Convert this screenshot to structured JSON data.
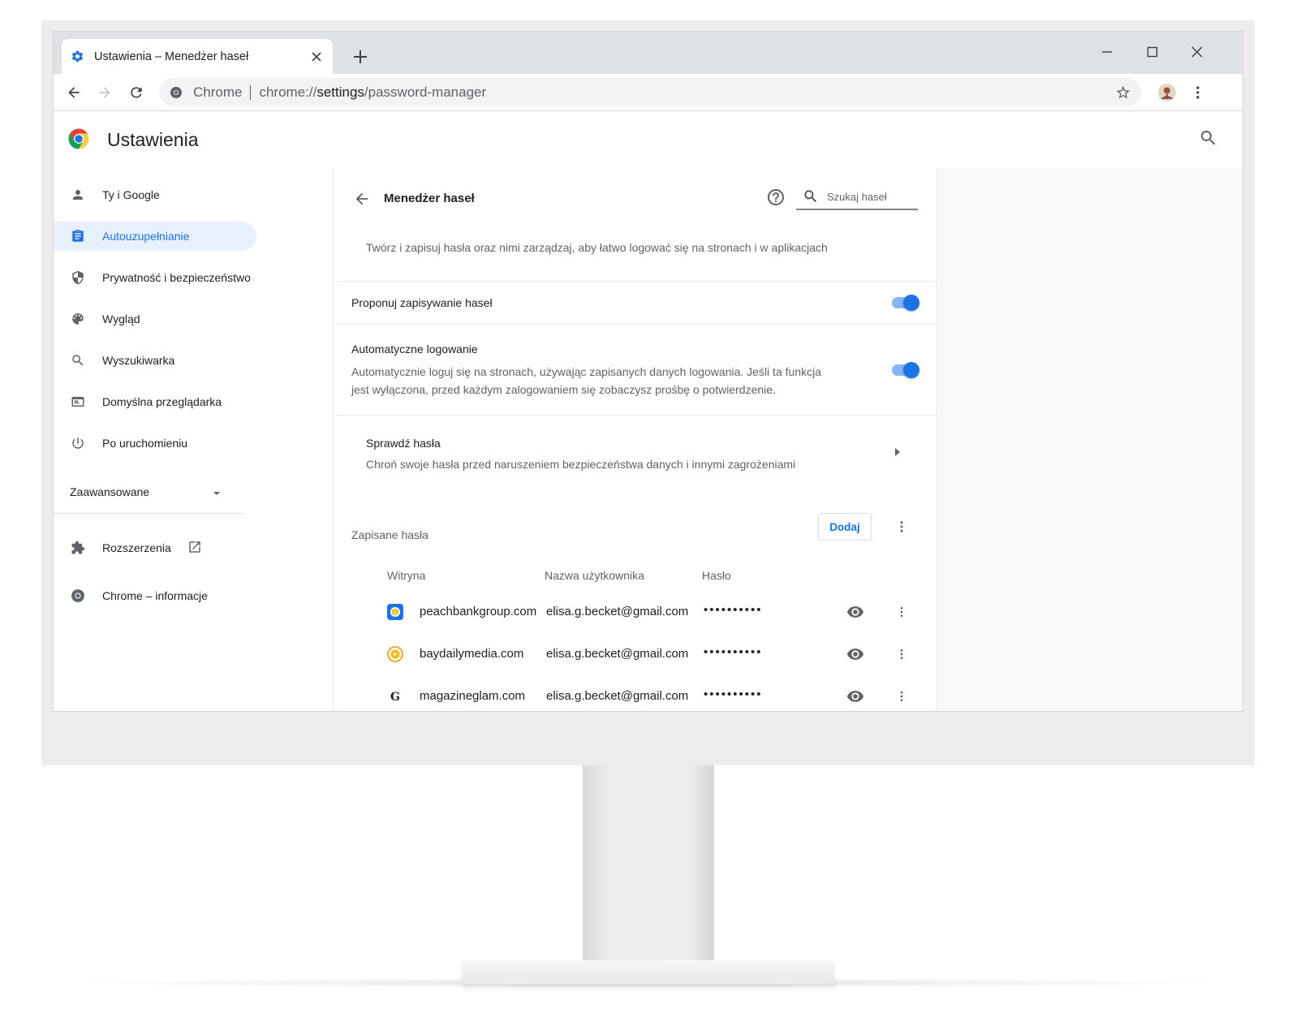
{
  "tab": {
    "title": "Ustawienia – Menedżer haseł",
    "favicon": "gear-icon"
  },
  "omnibox": {
    "scheme_label": "Chrome",
    "url_prefix": "chrome://",
    "url_host": "settings",
    "url_path": "/password-manager"
  },
  "settings": {
    "title": "Ustawienia"
  },
  "sidebar": {
    "items": [
      {
        "label": "Ty i Google",
        "icon": "person-icon",
        "active": false
      },
      {
        "label": "Autouzupełnianie",
        "icon": "clipboard-icon",
        "active": true
      },
      {
        "label": "Prywatność i bezpieczeństwo",
        "icon": "shield-icon",
        "active": false
      },
      {
        "label": "Wygląd",
        "icon": "palette-icon",
        "active": false
      },
      {
        "label": "Wyszukiwarka",
        "icon": "search-icon",
        "active": false
      },
      {
        "label": "Domyślna przeglądarka",
        "icon": "browser-icon",
        "active": false
      },
      {
        "label": "Po uruchomieniu",
        "icon": "power-icon",
        "active": false
      }
    ],
    "advanced_label": "Zaawansowane",
    "extensions_label": "Rozszerzenia",
    "about_label": "Chrome – informacje"
  },
  "password_manager": {
    "title": "Menedżer haseł",
    "search_placeholder": "Szukaj haseł",
    "intro": "Twórz i zapisuj hasła oraz nimi zarządzaj, aby łatwo logować się na stronach i w aplikacjach",
    "offer_save_label": "Proponuj zapisywanie haseł",
    "offer_save_enabled": true,
    "auto_signin_label": "Automatyczne logowanie",
    "auto_signin_desc_line1": "Automatycznie loguj się na stronach, używając zapisanych danych logowania. Jeśli ta funkcja",
    "auto_signin_desc_line2": "jest wyłączona, przed każdym zalogowaniem się zobaczysz prośbę o potwierdzenie.",
    "auto_signin_enabled": true,
    "check_title": "Sprawdź hasła",
    "check_desc": "Chroń swoje hasła przed naruszeniem bezpieczeństwa danych i innymi zagrożeniami",
    "saved_title": "Zapisane hasła",
    "add_label": "Dodaj",
    "columns": {
      "site": "Witryna",
      "username": "Nazwa użytkownika",
      "password": "Hasło"
    },
    "rows": [
      {
        "site": "peachbankgroup.com",
        "username": "elisa.g.becket@gmail.com",
        "password": "••••••••••",
        "icon_color": "#1a73e8"
      },
      {
        "site": "baydailymedia.com",
        "username": "elisa.g.becket@gmail.com",
        "password": "••••••••••",
        "icon_color": "#f29900"
      },
      {
        "site": "magazineglam.com",
        "username": "elisa.g.becket@gmail.com",
        "password": "••••••••••",
        "icon_color": "#202124"
      }
    ]
  }
}
